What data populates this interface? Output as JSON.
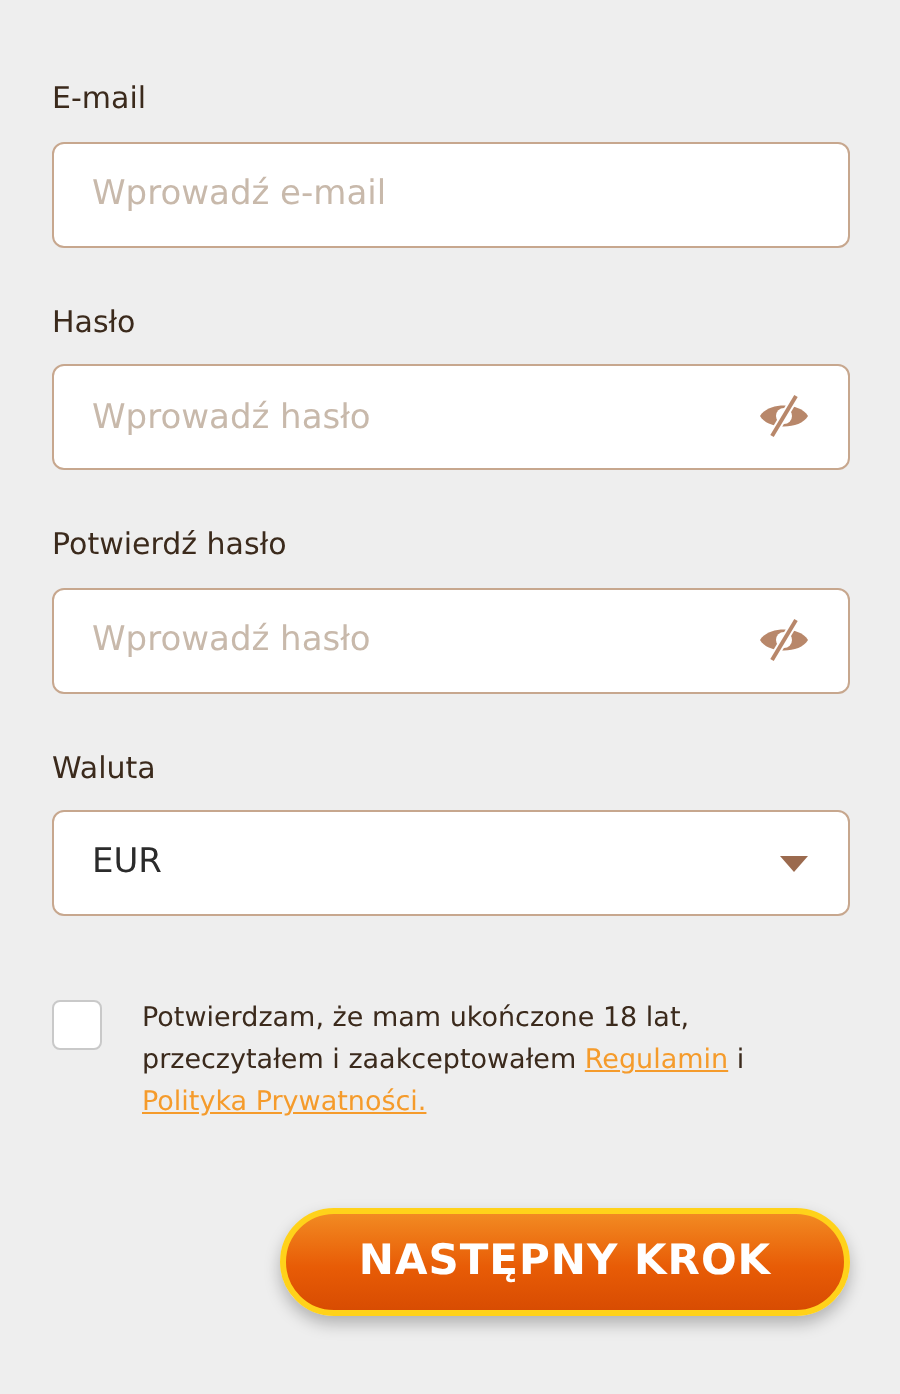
{
  "fields": [
    {
      "kind": "text",
      "label": "E-mail",
      "placeholder": "Wprowadź e-mail"
    },
    {
      "kind": "password",
      "label": "Hasło",
      "placeholder": "Wprowadź hasło"
    },
    {
      "kind": "password",
      "label": "Potwierdź hasło",
      "placeholder": "Wprowadź hasło"
    },
    {
      "kind": "select",
      "label": "Waluta",
      "value": "EUR"
    }
  ],
  "consent": {
    "checked": false,
    "parts": [
      {
        "kind": "text",
        "text": "Potwierdzam, że mam ukończone 18 lat, przeczytałem i zaakceptowałem "
      },
      {
        "kind": "link",
        "text": "Regulamin"
      },
      {
        "kind": "text",
        "text": " i "
      },
      {
        "kind": "link",
        "text": "Polityka Prywatności."
      }
    ]
  },
  "submit": {
    "label": "NASTĘPNY KROK"
  }
}
